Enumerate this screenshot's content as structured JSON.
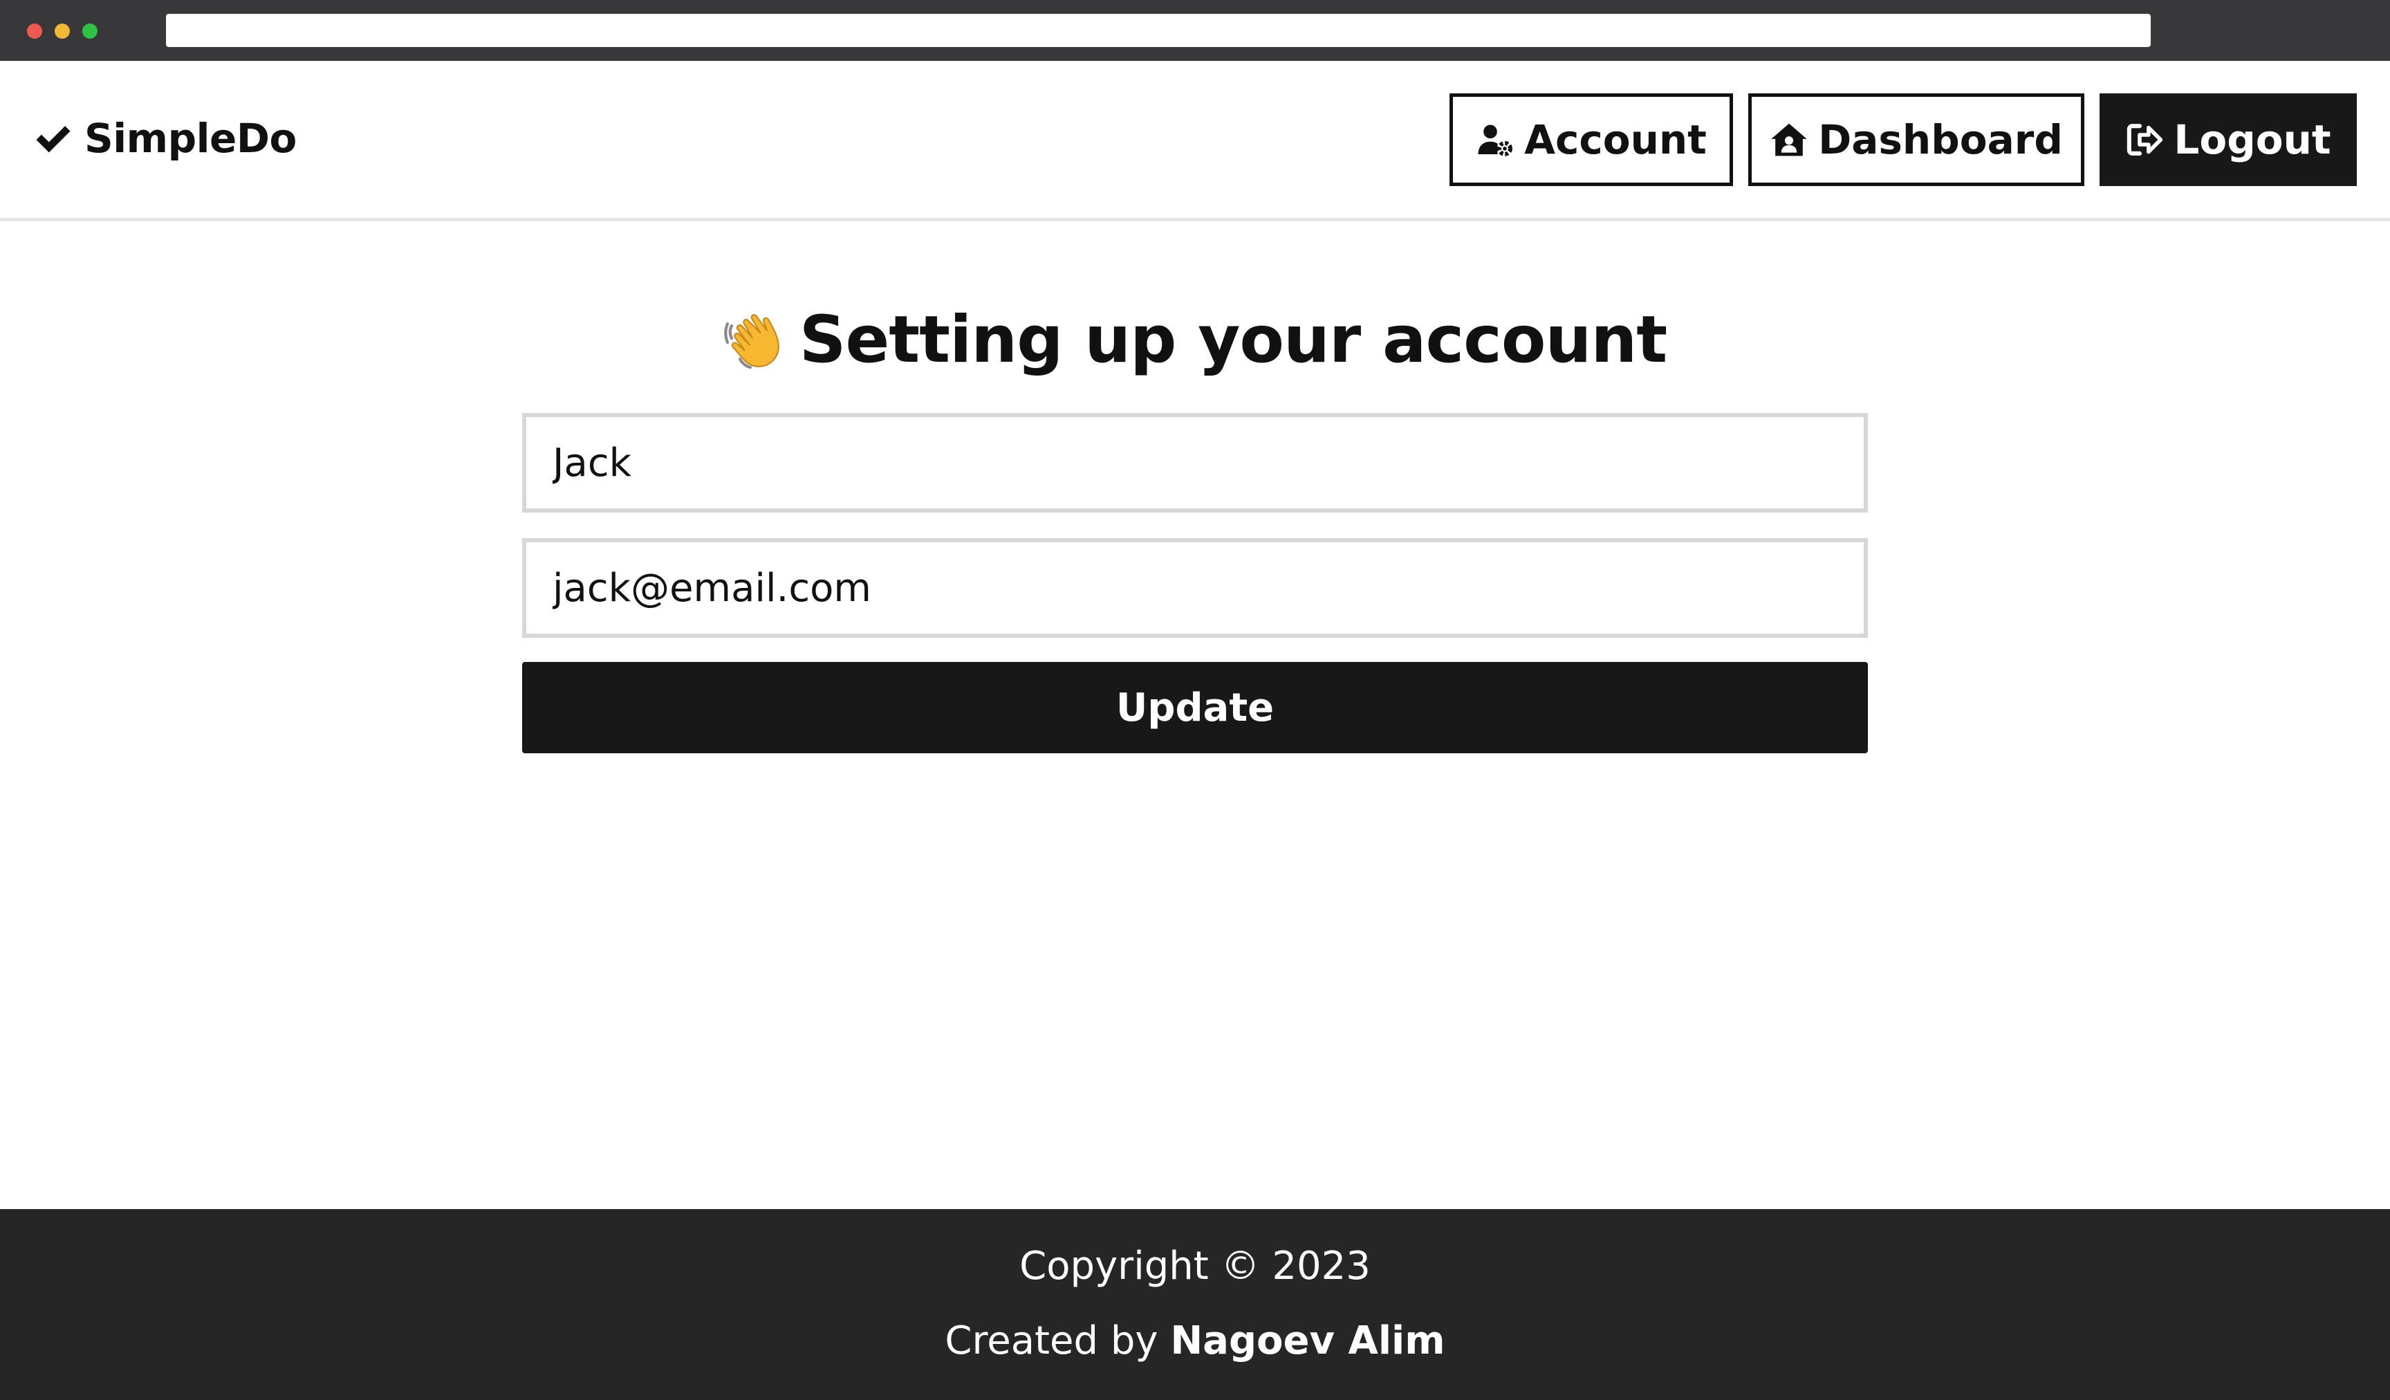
{
  "browser": {
    "url": ""
  },
  "header": {
    "brand": "SimpleDo",
    "nav": {
      "account_label": "Account",
      "dashboard_label": "Dashboard",
      "logout_label": "Logout"
    }
  },
  "main": {
    "title": "Setting up your account",
    "form": {
      "name_value": "Jack",
      "email_value": "jack@email.com",
      "submit_label": "Update"
    }
  },
  "footer": {
    "copyright": "Copyright © 2023",
    "credit_prefix": "Created by",
    "credit_author": "Nagoev Alim"
  },
  "icons": {
    "brand": "check-icon",
    "account": "user-gear-icon",
    "dashboard": "house-user-icon",
    "logout": "sign-out-icon",
    "title": "waving-hand-icon"
  },
  "colors": {
    "primary": "#181818",
    "footer_bg": "#262626",
    "input_border": "#d7d7d7",
    "chrome_bg": "#38383b"
  }
}
